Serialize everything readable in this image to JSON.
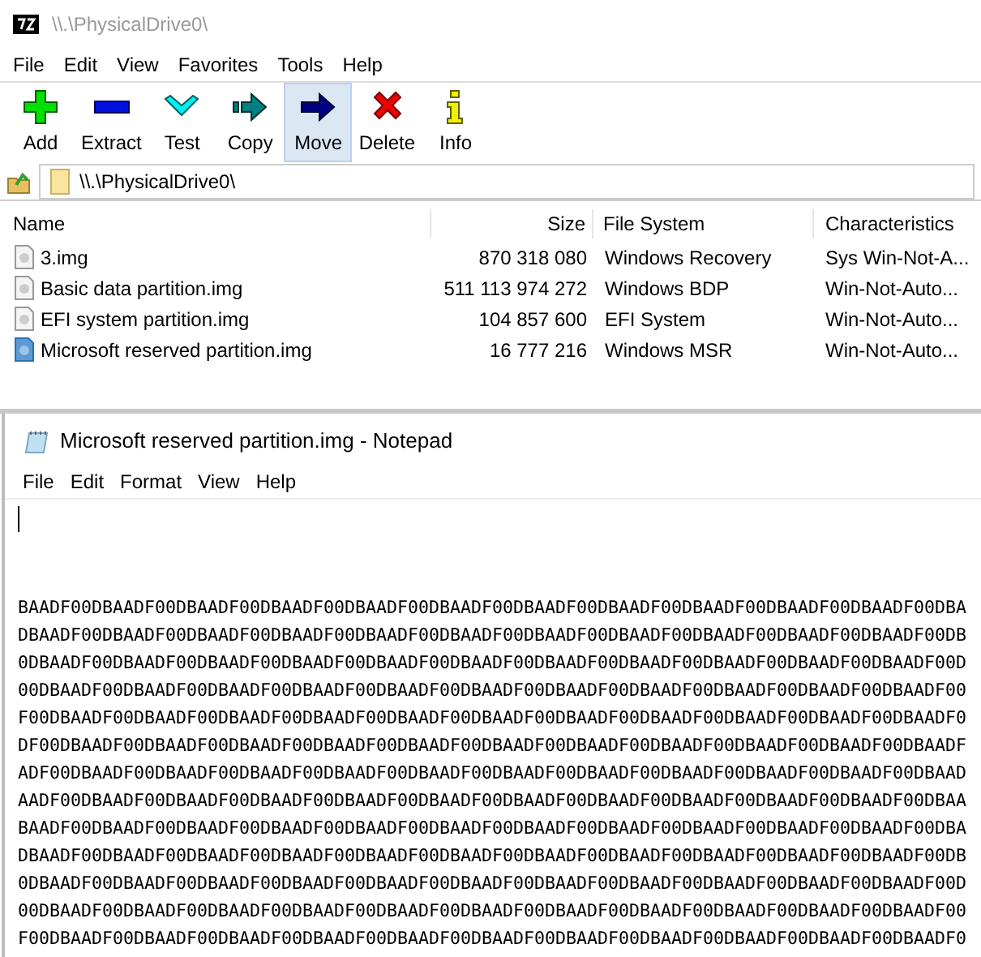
{
  "window": {
    "title": "\\\\.\\PhysicalDrive0\\"
  },
  "menu": [
    "File",
    "Edit",
    "View",
    "Favorites",
    "Tools",
    "Help"
  ],
  "toolbar": [
    {
      "label": "Add",
      "kind": "add",
      "highlighted": false
    },
    {
      "label": "Extract",
      "kind": "extract",
      "highlighted": false
    },
    {
      "label": "Test",
      "kind": "test",
      "highlighted": false
    },
    {
      "label": "Copy",
      "kind": "copy",
      "highlighted": false
    },
    {
      "label": "Move",
      "kind": "move",
      "highlighted": true
    },
    {
      "label": "Delete",
      "kind": "delete",
      "highlighted": false
    },
    {
      "label": "Info",
      "kind": "info",
      "highlighted": false
    }
  ],
  "address": "\\\\.\\PhysicalDrive0\\",
  "table": {
    "columns": [
      "Name",
      "Size",
      "File System",
      "Characteristics"
    ],
    "rows": [
      {
        "name": "3.img",
        "size": "870 318 080",
        "file_system": "Windows Recovery",
        "characteristics": "Sys Win-Not-A...",
        "selected": false
      },
      {
        "name": "Basic data partition.img",
        "size": "511 113 974 272",
        "file_system": "Windows BDP",
        "characteristics": "Win-Not-Auto...",
        "selected": false
      },
      {
        "name": "EFI system partition.img",
        "size": "104 857 600",
        "file_system": "EFI System",
        "characteristics": "Win-Not-Auto...",
        "selected": false
      },
      {
        "name": "Microsoft reserved partition.img",
        "size": "16 777 216",
        "file_system": "Windows MSR",
        "characteristics": "Win-Not-Auto...",
        "selected": true
      }
    ]
  },
  "notepad": {
    "title": "Microsoft reserved partition.img - Notepad",
    "menu": [
      "File",
      "Edit",
      "Format",
      "View",
      "Help"
    ],
    "lines": [
      "BAADF00DBAADF00DBAADF00DBAADF00DBAADF00DBAADF00DBAADF00DBAADF00DBAADF00DBAADF00DBAADF00DBA",
      "DBAADF00DBAADF00DBAADF00DBAADF00DBAADF00DBAADF00DBAADF00DBAADF00DBAADF00DBAADF00DBAADF00DB",
      "0DBAADF00DBAADF00DBAADF00DBAADF00DBAADF00DBAADF00DBAADF00DBAADF00DBAADF00DBAADF00DBAADF00D",
      "00DBAADF00DBAADF00DBAADF00DBAADF00DBAADF00DBAADF00DBAADF00DBAADF00DBAADF00DBAADF00DBAADF00",
      "F00DBAADF00DBAADF00DBAADF00DBAADF00DBAADF00DBAADF00DBAADF00DBAADF00DBAADF00DBAADF00DBAADF0",
      "DF00DBAADF00DBAADF00DBAADF00DBAADF00DBAADF00DBAADF00DBAADF00DBAADF00DBAADF00DBAADF00DBAADF",
      "ADF00DBAADF00DBAADF00DBAADF00DBAADF00DBAADF00DBAADF00DBAADF00DBAADF00DBAADF00DBAADF00DBAAD",
      "AADF00DBAADF00DBAADF00DBAADF00DBAADF00DBAADF00DBAADF00DBAADF00DBAADF00DBAADF00DBAADF00DBAA",
      "BAADF00DBAADF00DBAADF00DBAADF00DBAADF00DBAADF00DBAADF00DBAADF00DBAADF00DBAADF00DBAADF00DBA",
      "DBAADF00DBAADF00DBAADF00DBAADF00DBAADF00DBAADF00DBAADF00DBAADF00DBAADF00DBAADF00DBAADF00DB",
      "0DBAADF00DBAADF00DBAADF00DBAADF00DBAADF00DBAADF00DBAADF00DBAADF00DBAADF00DBAADF00DBAADF00D",
      "00DBAADF00DBAADF00DBAADF00DBAADF00DBAADF00DBAADF00DBAADF00DBAADF00DBAADF00DBAADF00DBAADF00",
      "F00DBAADF00DBAADF00DBAADF00DBAADF00DBAADF00DBAADF00DBAADF00DBAADF00DBAADF00DBAADF00DBAADF0"
    ]
  }
}
